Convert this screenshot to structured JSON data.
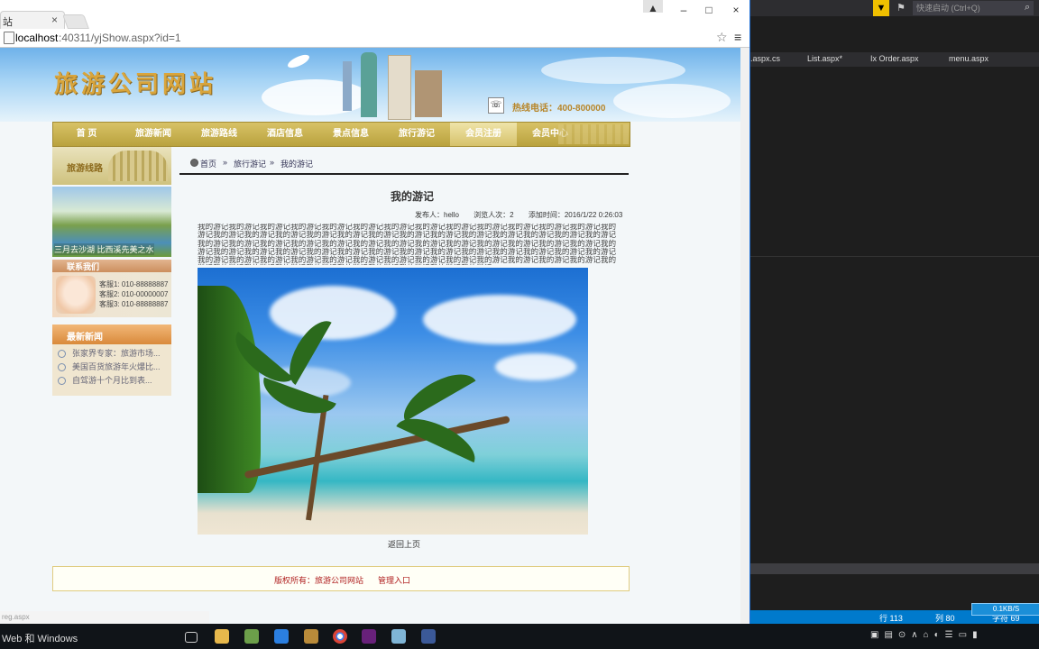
{
  "browser": {
    "tab_title": "站",
    "tab_close": "×",
    "url_host": "localhost",
    "url_path": ":40311/yjShow.aspx?id=1",
    "window_controls": {
      "minimize": "–",
      "restore": "□",
      "close": "×"
    },
    "status_url": "reg.aspx"
  },
  "site": {
    "title": "旅游公司网站",
    "hotline": "热线电话：400-800000",
    "nav": [
      "首 页",
      "旅游新闻",
      "旅游路线",
      "酒店信息",
      "景点信息",
      "旅行游记",
      "会员注册",
      "会员中心"
    ],
    "nav_active_index": 6,
    "sidebar": {
      "promo_label": "旅游线路",
      "photo_caption": "三月去沙湖 比西溪先美之水",
      "contact_title": "联系我们",
      "contact_lines": [
        "客服1: 010-88888887",
        "客服2: 010-00000007",
        "客服3: 010-88888887"
      ],
      "news_title": "最新新闻",
      "news_items": [
        "张家界专家：旅游市场...",
        "美国百货旅游年火爆比...",
        "自驾游十个月比到表..."
      ]
    },
    "breadcrumb": {
      "home": "首页",
      "sep": "»",
      "level1": "旅行游记",
      "current": "我的游记"
    },
    "article": {
      "title": "我的游记",
      "author": "发布人：hello",
      "views": "浏览人次：2",
      "date": "添加时间：2016/1/22 0:26:03",
      "body": "我的游记我的游记我的游记我的游记我的游记我的游记我的游记我的游记我的游记我的游记我的游记我的游记我的游记我的游记我的游记我的游记我的游记我的游记我的游记我的游记我的游记我的游记我的游记我的游记我的游记我的游记我的游记我的游记我的游记我的游记我的游记我的游记我的游记我的游记我的游记我的游记我的游记我的游记我的游记我的游记我的游记我的游记我的游记我的游记我的游记我的游记我的游记我的游记我的游记我的游记我的游记我的游记我的游记我的游记我的游记我的游记我的游记我的游记我的游记我的游记我的游记我的游记我的游记我的游记我的游记我的游记我的游记我的游记我的游记我的游记我的游记我的游记我的游记我的游记我的游记我的游记我的游记",
      "back": "返回上页"
    },
    "footer": {
      "copyright": "版权所有：旅游公司网站",
      "admin": "管理入口"
    }
  },
  "vs": {
    "search_placeholder": "快速启动 (Ctrl+Q)",
    "tabs": [
      ".aspx.cs",
      "List.aspx*",
      "Ix Order.aspx",
      "menu.aspx"
    ],
    "status": {
      "line": "行 113",
      "col": "列 80",
      "ch": "字符 69"
    },
    "net": "0.1KB/S"
  },
  "taskbar": {
    "text": "Web 和 Windows"
  }
}
